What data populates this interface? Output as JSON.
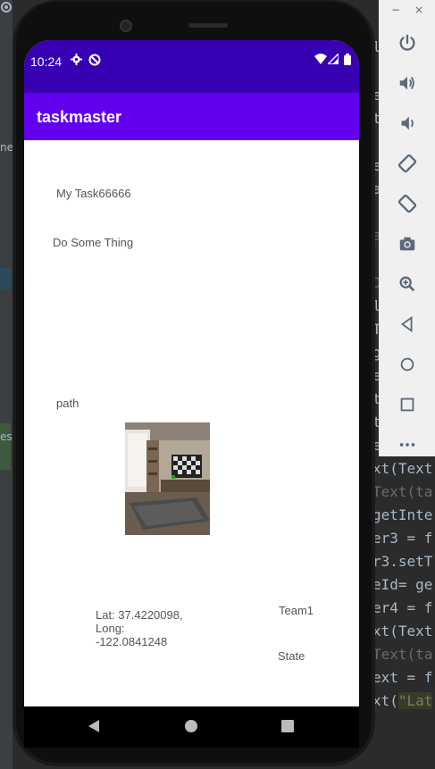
{
  "status_bar": {
    "time": "10:24",
    "icons": [
      "settings-icon",
      "no-sync-icon",
      "wifi-icon",
      "signal-icon",
      "battery-icon"
    ]
  },
  "app": {
    "title": "taskmaster"
  },
  "task": {
    "title": "My Task66666",
    "body": "Do Some Thing",
    "path_label": "path",
    "location": "Lat: 37.4220098,\nLong:\n-122.0841248",
    "team": "Team1",
    "state": "State"
  },
  "emulator_toolbar": {
    "minimize_label": "−",
    "close_label": "×",
    "buttons": [
      "power-icon",
      "volume-up-icon",
      "volume-down-icon",
      "rotate-left-icon",
      "rotate-right-icon",
      "screenshot-icon",
      "zoom-icon",
      "back-icon",
      "home-icon",
      "overview-icon",
      "more-icon"
    ]
  },
  "ide_code_lines": [
    {
      "text": "l",
      "dim": false
    },
    {
      "text": "e",
      "dim": false
    },
    {
      "text": "t",
      "dim": false
    },
    {
      "text": "e",
      "dim": false
    },
    {
      "text": "a",
      "dim": false
    },
    {
      "text": "a",
      "dim": true
    },
    {
      "text": "D",
      "dim": true
    },
    {
      "text": "l",
      "dim": false
    },
    {
      "text": "T",
      "dim": false
    },
    {
      "text": "g",
      "dim": false
    },
    {
      "text": "e",
      "dim": false
    },
    {
      "text": "t",
      "dim": false
    },
    {
      "text": "t",
      "dim": false
    },
    {
      "text": "e",
      "dim": false
    },
    {
      "text": "xt(Text",
      "dim": false
    },
    {
      "text": "Text(ta",
      "dim": true
    },
    {
      "text": "getInte",
      "dim": false
    },
    {
      "text": "er3 = f",
      "dim": false
    },
    {
      "text": "r3.setT",
      "dim": false
    },
    {
      "text": "eId= ge",
      "dim": false
    },
    {
      "text": "er4 = f",
      "dim": false
    },
    {
      "text": "xt(Text",
      "dim": false
    },
    {
      "text": "Text(ta",
      "dim": true
    },
    {
      "text": "ext = f",
      "dim": false
    },
    {
      "text": "xt(",
      "dim": false,
      "str": "\"Lat"
    }
  ],
  "ide_left": {
    "glyph_1": "ne",
    "glyph_2": "es"
  }
}
